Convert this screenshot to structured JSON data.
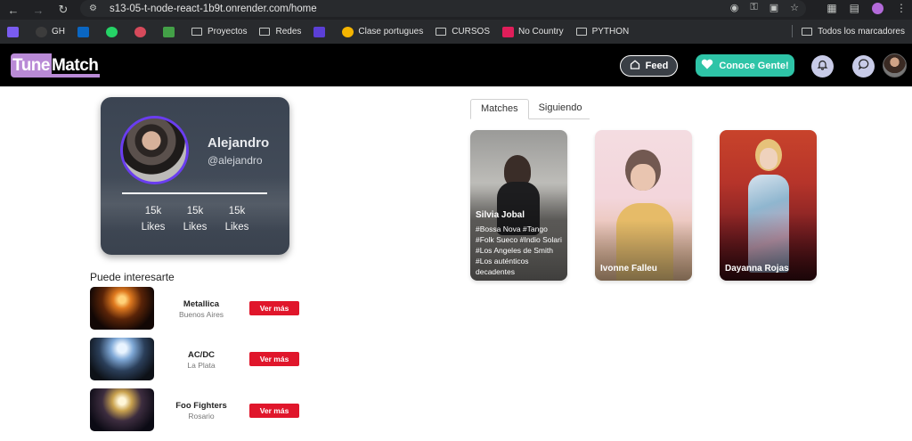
{
  "browser": {
    "url": "s13-05-t-node-react-1b9t.onrender.com/home",
    "bookmarks": [
      "GH",
      "Proyectos",
      "Redes",
      "Clase portugues",
      "CURSOS",
      "No Country",
      "PYTHON"
    ],
    "all_bookmarks": "Todos los marcadores"
  },
  "header": {
    "logo_tune": "Tune",
    "logo_match": "Match",
    "feed_label": "Feed",
    "conoce_label": "Conoce Gente!"
  },
  "profile": {
    "name": "Alejandro",
    "handle": "@alejandro",
    "stats": [
      {
        "value": "15k",
        "label": "Likes"
      },
      {
        "value": "15k",
        "label": "Likes"
      },
      {
        "value": "15k",
        "label": "Likes"
      }
    ]
  },
  "recommendations": {
    "title": "Puede interesarte",
    "items": [
      {
        "name": "Metallica",
        "city": "Buenos Aires",
        "button": "Ver más"
      },
      {
        "name": "AC/DC",
        "city": "La Plata",
        "button": "Ver más"
      },
      {
        "name": "Foo Fighters",
        "city": "Rosario",
        "button": "Ver más"
      }
    ]
  },
  "tabs": [
    "Matches",
    "Siguiendo"
  ],
  "matches": [
    {
      "name": "Silvia Jobal",
      "tags": "#Bossa Nova #Tango #Folk Sueco #Indio Solari #Los Angeles de Smith #Los auténticos decadentes"
    },
    {
      "name": "Ivonne Falleu",
      "tags": ""
    },
    {
      "name": "Dayanna Rojas",
      "tags": ""
    }
  ]
}
